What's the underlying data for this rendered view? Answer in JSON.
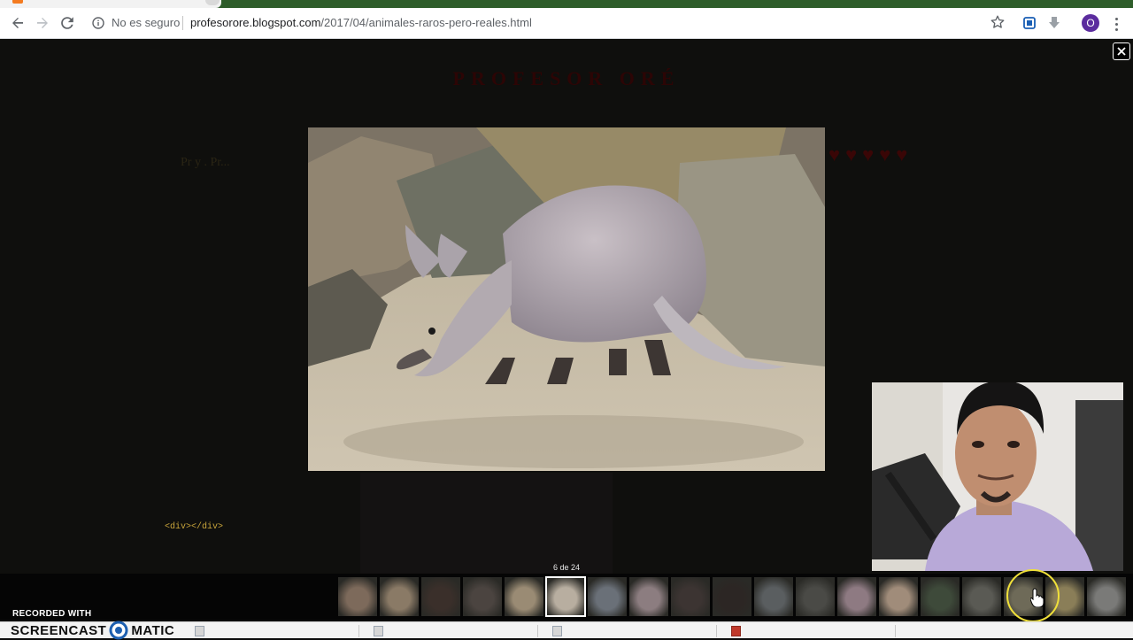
{
  "browser": {
    "security_label": "No es seguro",
    "url_host": "profesorore.blogspot.com",
    "url_path": "/2017/04/animales-raros-pero-reales.html",
    "profile_initial": "O",
    "accent": "#1a73e8"
  },
  "blog": {
    "title": "PROFESOR ORÉ",
    "breadcrumb": "Pr y . Pr..."
  },
  "lightbox": {
    "counter": "6 de 24",
    "selected_index": 5,
    "thumb_count": 19
  },
  "overlay": {
    "div_label": "<div></div>",
    "recorded_label": "RECORDED WITH",
    "brand": {
      "left": "SCREENCAST",
      "right": "MATIC"
    }
  },
  "colors": {
    "page_bg": "#0f0f0d",
    "title_dim": "#2c0505",
    "cursor_ring": "#f0e03a"
  }
}
